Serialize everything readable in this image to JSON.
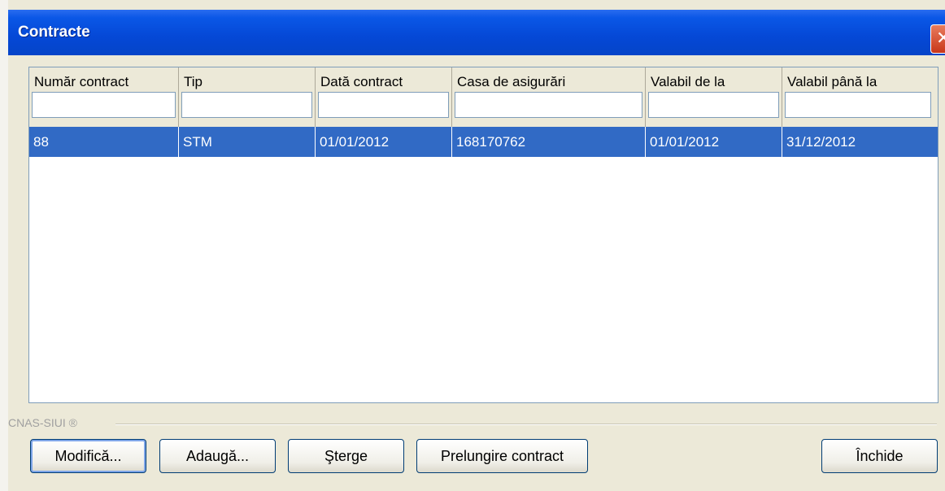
{
  "window": {
    "title": "Contracte"
  },
  "grid": {
    "columns": [
      "Număr contract",
      "Tip",
      "Dată contract",
      "Casa de asigurări",
      "Valabil de la",
      "Valabil până la"
    ],
    "rows": [
      [
        "88",
        "STM",
        "01/01/2012",
        "168170762",
        "01/01/2012",
        "31/12/2012"
      ]
    ]
  },
  "footer": {
    "label": "CNAS-SIUI ®"
  },
  "buttons": {
    "modifica": "Modifică...",
    "adauga": "Adaugă...",
    "sterge": "Şterge",
    "prelungire": "Prelungire contract",
    "inchide": "Închide"
  },
  "colors": {
    "titlebar": "#0548d6",
    "selection": "#316ac5",
    "face": "#ece9d8"
  }
}
